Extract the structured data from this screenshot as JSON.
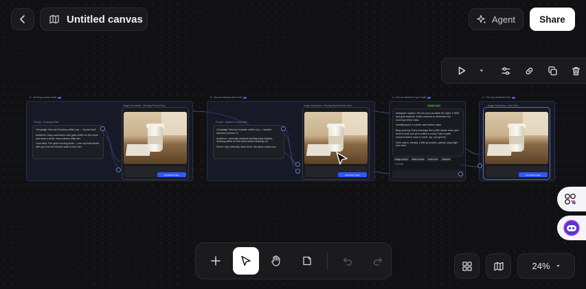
{
  "header": {
    "title": "Untitled canvas",
    "agent_label": "Agent",
    "share_label": "Share"
  },
  "canvas": {
    "groups": [
      {
        "label": "A - Morning Launch Draft",
        "text_label": "Prompt - Campaign Brief",
        "text_lines": [
          "Campaign: Morrow Roastery coffee cup — launch brief",
          "Audience: busy commuters who grab coffee on the move and want a small, easy outdoor daily win.",
          "Core idea: The quiet morning ritual — one cup that travels with you from the kitchen table to the train."
        ],
        "image_label": "Image Generation - Morning Product Shot",
        "generate_label": "Generate Image"
      },
      {
        "label": "B - Morrow Student Arts Draft",
        "text_label": "Prompt - Student Concept Brief",
        "text_lines": [
          "Campaign: Morrow reusable coffee cup — student direction (version 2)",
          "Audience: university students starting early classes, drinking coffee at their desk before heading out.",
          "Scene: tidy university dorm desk, the same cream cup."
        ],
        "image_label": "Image Generation - Morning Student Desk Shot",
        "generate_label": "Generate Image"
      },
      {
        "label": "A - Morrow Student Copy Drafts",
        "badge": "Output - Text",
        "text_lines": [
          "Instagram caption: Get set your reusable the night. A 9PM and grab anytime: better moment to remember the morning before class.",
          "Headline/post: a calmer start before class",
          "Blog opening: Early mornings feel a little easier when your desk is clear and your coffee is ready. Take a quiet moment before class to reset, sip, and get set.",
          "Tone: warm, friendly, a little grounded, upbeat; stays light and clear."
        ],
        "chips": [
          "Image prompt",
          "Video prompt",
          "Voice over",
          "Captions"
        ],
        "footer_label": "Formats"
      },
      {
        "label": "A - The Key Aesthetic Film",
        "image_label": "Image Generation - Hero Shot",
        "generate_label": "Generate Image"
      }
    ]
  },
  "bottom_toolbar": {
    "tools": [
      "add",
      "select",
      "hand",
      "note",
      "undo",
      "redo"
    ],
    "active_tool": "select"
  },
  "zoom": {
    "level": "24%"
  },
  "icons": {
    "back": "chevron-left-icon",
    "map": "map-icon",
    "agent": "sparkle-icon",
    "run": "play-icon",
    "settings": "sliders-icon",
    "link": "link-icon",
    "copy": "copy-icon",
    "delete": "trash-icon"
  },
  "colors": {
    "accent": "#2e5bff",
    "background": "#111113",
    "share_button": "#ffffff"
  }
}
